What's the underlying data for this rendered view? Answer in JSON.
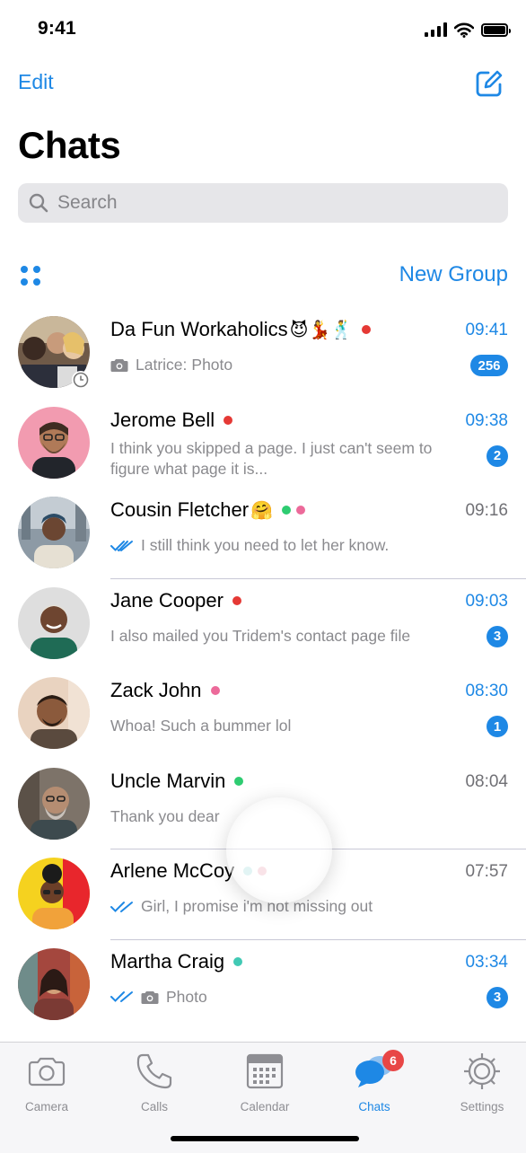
{
  "status_bar": {
    "time": "9:41"
  },
  "nav": {
    "edit_label": "Edit",
    "title": "Chats"
  },
  "search": {
    "placeholder": "Search"
  },
  "toolbar": {
    "new_group_label": "New Group"
  },
  "colors": {
    "accent": "#1e88e5",
    "status_red": "#e53935",
    "status_green": "#2ecc71",
    "status_pink": "#ec6a9a",
    "status_teal": "#41c9b4",
    "status_light_teal": "#bfe6e6",
    "status_light_pink": "#f2c2cd",
    "tab_badge": "#e84646"
  },
  "chats": [
    {
      "name": "Da Fun Workaholics",
      "emoji": "😈💃🕺",
      "status": [
        "red"
      ],
      "time": "09:41",
      "sender": "Latrice:",
      "preview": "Photo",
      "badge": "256",
      "photo_icon": true
    },
    {
      "name": "Jerome Bell",
      "status": [
        "red"
      ],
      "time": "09:38",
      "preview": "I think you skipped a page. I just can't seem to figure what page it is...",
      "badge": "2"
    },
    {
      "name": "Cousin Fletcher",
      "emoji": "🤗",
      "status": [
        "green",
        "pink"
      ],
      "time": "09:16",
      "preview": "I still think you need to let her know.",
      "read": true
    },
    {
      "name": "Jane Cooper",
      "status": [
        "red"
      ],
      "time": "09:03",
      "preview": "I also mailed you Tridem's contact page file",
      "badge": "3"
    },
    {
      "name": "Zack John",
      "status": [
        "pink"
      ],
      "time": "08:30",
      "preview": "Whoa! Such a bummer lol",
      "badge": "1"
    },
    {
      "name": "Uncle Marvin",
      "status": [
        "green"
      ],
      "time": "08:04",
      "preview": "Thank you dear"
    },
    {
      "name": "Arlene McCoy",
      "status": [
        "light_teal",
        "light_pink"
      ],
      "time": "07:57",
      "preview": "Girl, I promise i'm not missing out",
      "read": true
    },
    {
      "name": "Martha Craig",
      "status": [
        "teal"
      ],
      "time": "03:34",
      "preview": "Photo",
      "badge": "3",
      "photo_icon": true,
      "read_check": true
    }
  ],
  "tabs": [
    {
      "label": "Camera",
      "icon": "camera-icon"
    },
    {
      "label": "Calls",
      "icon": "phone-icon"
    },
    {
      "label": "Calendar",
      "icon": "calendar-icon"
    },
    {
      "label": "Chats",
      "icon": "chat-bubbles-icon",
      "badge": "6",
      "active": true
    },
    {
      "label": "Settings",
      "icon": "gear-icon"
    }
  ]
}
